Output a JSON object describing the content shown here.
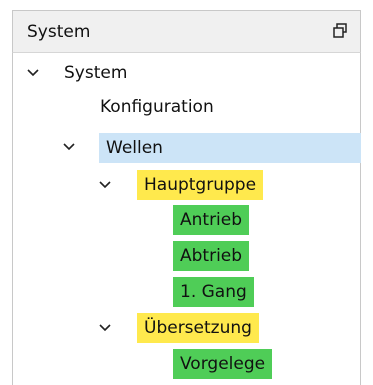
{
  "panel": {
    "title": "System"
  },
  "tree": {
    "root": {
      "label": "System",
      "children": {
        "konfiguration": {
          "label": "Konfiguration"
        },
        "wellen": {
          "label": "Wellen",
          "groups": [
            {
              "label": "Hauptgruppe",
              "items": [
                "Antrieb",
                "Abtrieb",
                "1. Gang"
              ]
            },
            {
              "label": "Übersetzung",
              "items": [
                "Vorgelege"
              ]
            }
          ]
        }
      }
    }
  },
  "colors": {
    "selected_bg": "#cce4f7",
    "group_highlight": "#ffe94d",
    "leaf_highlight": "#4fcd57"
  },
  "icons": {
    "float": "restore-float-icon",
    "expand": "chevron-down-icon"
  }
}
